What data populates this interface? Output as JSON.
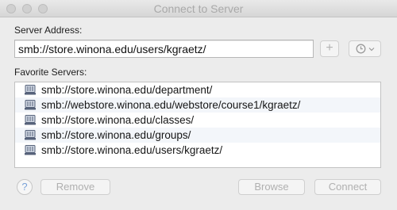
{
  "window": {
    "title": "Connect to Server"
  },
  "server_address": {
    "label": "Server Address:",
    "value": "smb://store.winona.edu/users/kgraetz/"
  },
  "favorites": {
    "label": "Favorite Servers:",
    "items": [
      "smb://store.winona.edu/department/",
      "smb://webstore.winona.edu/webstore/course1/kgraetz/",
      "smb://store.winona.edu/classes/",
      "smb://store.winona.edu/groups/",
      "smb://store.winona.edu/users/kgraetz/"
    ]
  },
  "buttons": {
    "add": "+",
    "help": "?",
    "remove": "Remove",
    "browse": "Browse",
    "connect": "Connect"
  },
  "icons": {
    "server": "network-server-icon",
    "recent": "recent-servers-clock-icon"
  },
  "colors": {
    "accent": "#7aa2d8",
    "disabled_text": "#b0b0b0",
    "row_alt": "#f3f6fa"
  }
}
